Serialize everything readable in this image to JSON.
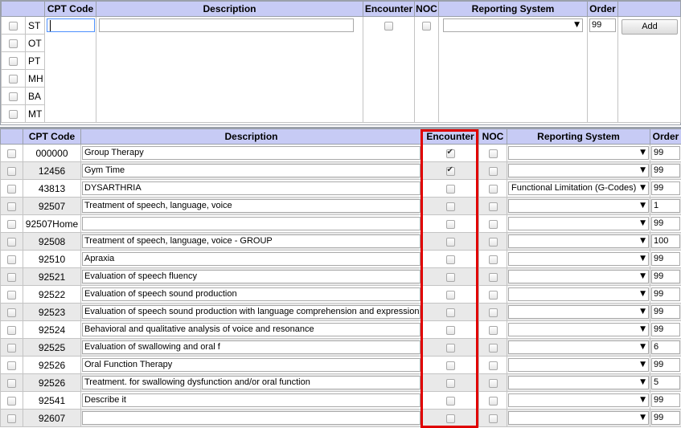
{
  "top_form": {
    "headers": {
      "cpt_code": "CPT Code",
      "description": "Description",
      "encounter": "Encounter",
      "noc": "NOC",
      "reporting_system": "Reporting System",
      "order": "Order"
    },
    "disciplines": [
      {
        "label": "ST",
        "checked": false
      },
      {
        "label": "OT",
        "checked": false
      },
      {
        "label": "PT",
        "checked": false
      },
      {
        "label": "MH",
        "checked": false
      },
      {
        "label": "BA",
        "checked": false
      },
      {
        "label": "MT",
        "checked": false
      }
    ],
    "cpt_code_value": "",
    "description_value": "",
    "encounter_checked": false,
    "noc_checked": false,
    "reporting_system_value": "",
    "order_value": "99",
    "add_button_label": "Add"
  },
  "table": {
    "headers": {
      "cpt_code": "CPT Code",
      "description": "Description",
      "encounter": "Encounter",
      "noc": "NOC",
      "reporting_system": "Reporting System",
      "order": "Order"
    },
    "rows": [
      {
        "code": "000000",
        "description": "Group Therapy",
        "encounter": true,
        "noc": false,
        "reporting": "",
        "order": "99"
      },
      {
        "code": "12456",
        "description": "Gym Time",
        "encounter": true,
        "noc": false,
        "reporting": "",
        "order": "99"
      },
      {
        "code": "43813",
        "description": "DYSARTHRIA",
        "encounter": false,
        "noc": false,
        "reporting": "Functional Limitation (G-Codes)",
        "order": "99"
      },
      {
        "code": "92507",
        "description": "Treatment of speech, language, voice",
        "encounter": false,
        "noc": false,
        "reporting": "",
        "order": "1"
      },
      {
        "code": "92507Home",
        "description": "",
        "encounter": false,
        "noc": false,
        "reporting": "",
        "order": "99"
      },
      {
        "code": "92508",
        "description": "Treatment of speech, language, voice - GROUP",
        "encounter": false,
        "noc": false,
        "reporting": "",
        "order": "100"
      },
      {
        "code": "92510",
        "description": "Apraxia",
        "encounter": false,
        "noc": false,
        "reporting": "",
        "order": "99"
      },
      {
        "code": "92521",
        "description": "Evaluation of speech fluency",
        "encounter": false,
        "noc": false,
        "reporting": "",
        "order": "99"
      },
      {
        "code": "92522",
        "description": "Evaluation of speech sound production",
        "encounter": false,
        "noc": false,
        "reporting": "",
        "order": "99"
      },
      {
        "code": "92523",
        "description": "Evaluation of speech sound production with language comprehension and expression",
        "encounter": false,
        "noc": false,
        "reporting": "",
        "order": "99"
      },
      {
        "code": "92524",
        "description": "Behavioral and qualitative analysis of voice and resonance",
        "encounter": false,
        "noc": false,
        "reporting": "",
        "order": "99"
      },
      {
        "code": "92525",
        "description": "Evaluation of swallowing and oral f",
        "encounter": false,
        "noc": false,
        "reporting": "",
        "order": "6"
      },
      {
        "code": "92526",
        "description": "Oral Function Therapy",
        "encounter": false,
        "noc": false,
        "reporting": "",
        "order": "99"
      },
      {
        "code": "92526",
        "description": "Treatment. for swallowing dysfunction and/or oral function",
        "encounter": false,
        "noc": false,
        "reporting": "",
        "order": "5"
      },
      {
        "code": "92541",
        "description": "Describe it",
        "encounter": false,
        "noc": false,
        "reporting": "",
        "order": "99"
      },
      {
        "code": "92607",
        "description": "",
        "encounter": false,
        "noc": false,
        "reporting": "",
        "order": "99"
      }
    ]
  },
  "highlight_color": "#e00000",
  "header_color": "#c7cbf5",
  "icons": {
    "dropdown": "chevron-down-icon",
    "checkmark": "checkmark-icon"
  }
}
